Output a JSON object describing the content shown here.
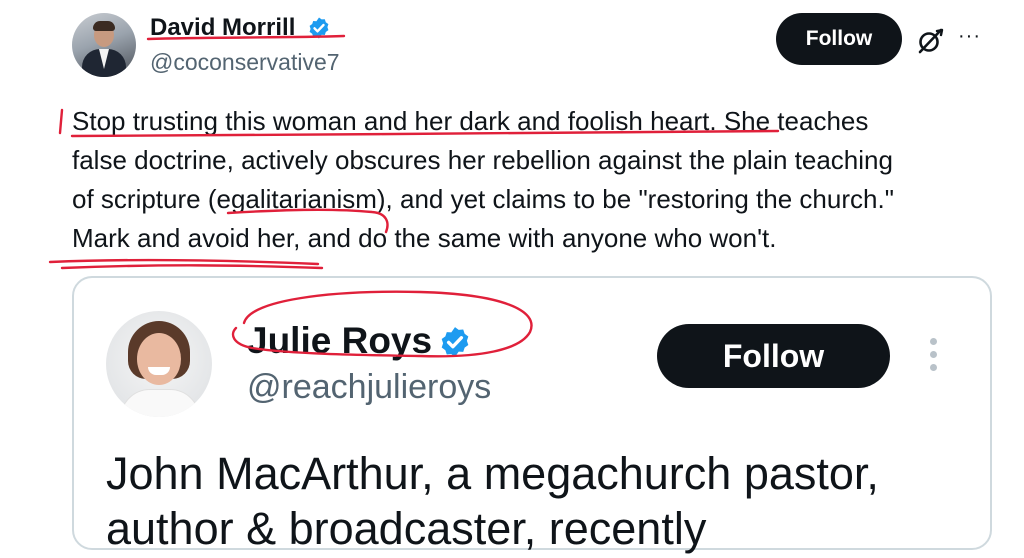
{
  "post": {
    "author_name": "David Morrill",
    "author_handle": "@coconservative7",
    "follow_label": "Follow",
    "more_label": "···",
    "text_lines": [
      "Stop trusting this woman and her dark and foolish heart. She teaches",
      "false doctrine, actively obscures her rebellion against the plain teaching",
      "of scripture (egalitarianism), and yet claims to be \"restoring the church.\"",
      "Mark and avoid her, and do the same with anyone who won't."
    ]
  },
  "quoted": {
    "author_name": "Julie Roys",
    "author_handle": "@reachjulieroys",
    "follow_label": "Follow",
    "text_line_1": "John MacArthur, a megachurch pastor,",
    "text_line_2": "author & broadcaster, recently"
  },
  "colors": {
    "verified": "#1d9bf0",
    "follow_bg": "#0f1419",
    "handle": "#536471",
    "annotation_red": "#e0203a"
  },
  "icons": [
    "verified-badge-icon",
    "grok-icon",
    "more-icon"
  ]
}
